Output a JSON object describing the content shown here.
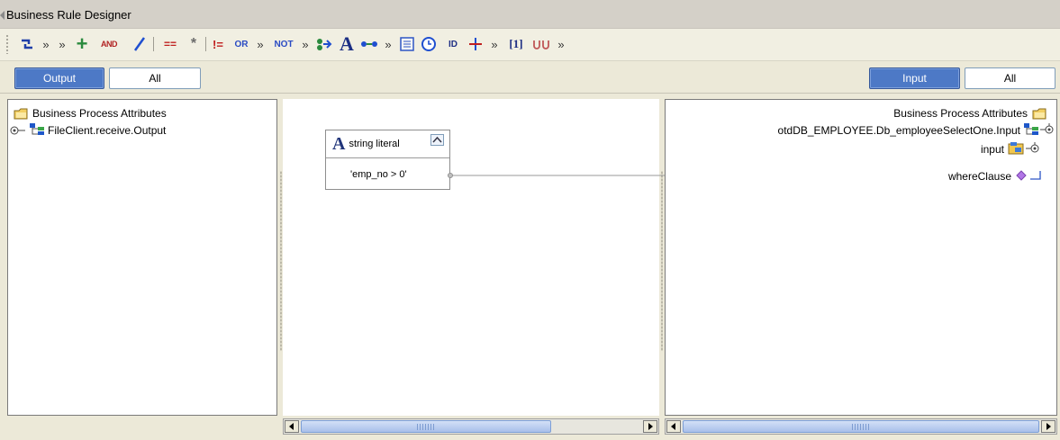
{
  "window": {
    "title": "Business Rule Designer"
  },
  "toolbar": {
    "items": [
      {
        "id": "link",
        "icon": "link-icon"
      },
      {
        "id": "more1",
        "text": "»"
      },
      {
        "id": "more2",
        "text": "»"
      },
      {
        "id": "add",
        "text": "+",
        "icon": "plus-icon"
      },
      {
        "id": "and",
        "text": "AND"
      },
      {
        "id": "divide",
        "text": "/",
        "icon": "divide-icon"
      },
      {
        "id": "equals",
        "text": "=="
      },
      {
        "id": "multiply",
        "text": "*",
        "icon": "multiply-icon"
      },
      {
        "id": "not-equals",
        "text": "!="
      },
      {
        "id": "or",
        "text": "OR"
      },
      {
        "id": "more3",
        "text": "»"
      },
      {
        "id": "not",
        "text": "NOT"
      },
      {
        "id": "more4",
        "text": "»"
      },
      {
        "id": "concat",
        "icon": "concat-icon"
      },
      {
        "id": "string-literal",
        "text": "A"
      },
      {
        "id": "substring",
        "icon": "substring-icon"
      },
      {
        "id": "more5",
        "text": "»"
      },
      {
        "id": "document",
        "icon": "document-icon"
      },
      {
        "id": "clock",
        "icon": "clock-icon"
      },
      {
        "id": "id-func",
        "text": "ID"
      },
      {
        "id": "split",
        "icon": "split-icon"
      },
      {
        "id": "more6",
        "text": "»"
      },
      {
        "id": "index",
        "text": "[1]"
      },
      {
        "id": "loop",
        "icon": "loop-icon"
      },
      {
        "id": "more7",
        "text": "»"
      }
    ]
  },
  "output_tabs": {
    "output_label": "Output",
    "all_label": "All"
  },
  "input_tabs": {
    "input_label": "Input",
    "all_label": "All"
  },
  "left_tree": {
    "root": "Business Process Attributes",
    "child": "FileClient.receive.Output"
  },
  "right_tree": {
    "root": "Business Process Attributes",
    "child": "otdDB_EMPLOYEE.Db_employeeSelectOne.Input",
    "input_node": "input",
    "where_node": "whereClause"
  },
  "card": {
    "title": "string literal",
    "value": "'emp_no > 0'"
  },
  "colors": {
    "accent": "#4d79c6",
    "connector": "#9a9a9a",
    "tree_blue": "#1e57c9",
    "tree_green": "#3aa648"
  }
}
